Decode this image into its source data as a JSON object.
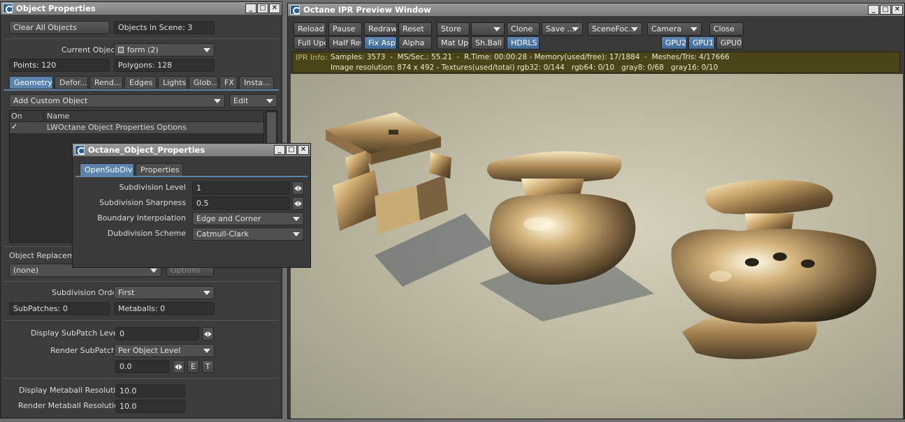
{
  "object_properties": {
    "title": "Object Properties",
    "clear_all": "Clear All Objects",
    "objects_in_scene": "Objects in Scene: 3",
    "current_object_label": "Current Object",
    "current_object_value": "form (2)",
    "points": "Points: 120",
    "polygons": "Polygons: 128",
    "tabs": [
      "Geometry",
      "Defor...",
      "Rend...",
      "Edges",
      "Lights",
      "Glob...",
      "FX",
      "Insta..."
    ],
    "add_custom_object": "Add Custom Object",
    "edit": "Edit",
    "list_headers": {
      "on": "On",
      "name": "Name"
    },
    "list_rows": [
      {
        "on": "✓",
        "name": "LWOctane Object Properties Options"
      }
    ],
    "object_replacement_label": "Object Replaceme",
    "object_replacement_value": "(none)",
    "options": "Options",
    "subdivision_order_label": "Subdivision Order",
    "subdivision_order_value": "First",
    "subpatches": "SubPatches: 0",
    "metaballs": "Metaballs: 0",
    "display_subpatch_label": "Display SubPatch Level",
    "display_subpatch_value": "0",
    "render_subpatch_label": "Render SubPatch",
    "render_subpatch_value": "Per Object Level",
    "render_subpatch_num": "0.0",
    "e_btn": "E",
    "t_btn": "T",
    "display_metaball_label": "Display Metaball Resolution",
    "display_metaball_value": "10.0",
    "render_metaball_label": "Render Metaball Resolution",
    "render_metaball_value": "10.0"
  },
  "octane_object": {
    "title": "Octane_Object_Properties",
    "tabs": [
      "OpenSubDiv",
      "Properties"
    ],
    "rows": [
      {
        "label": "Subdivision Level",
        "value": "1"
      },
      {
        "label": "Subdivision Sharpness",
        "value": "0.5"
      },
      {
        "label": "Boundary Interpolation",
        "value": "Edge and Corner"
      },
      {
        "label": "Dubdivision Scheme",
        "value": "Catmull-Clark"
      }
    ]
  },
  "ipr": {
    "title": "Octane IPR Preview Window",
    "row1": [
      "Reload",
      "Pause",
      "Redraw",
      "Reset",
      "Store",
      "",
      "Clone",
      "Save ...",
      "SceneFoc...",
      "Camera",
      "Close"
    ],
    "row2": [
      "Full Upd.",
      "Half Res",
      "Fix Asp.",
      "Alpha",
      "Mat Upd",
      "Sh.Ball",
      "HDRLS",
      "GPU2",
      "GPU1",
      "GPU0"
    ],
    "info_label": "IPR Info:",
    "info_line1": "Samples: 3573  -  MS/Sec.: 55.21  -  R.Time: 00:00:28 - Memory(used/free): 17/1884  -  Meshes/Tris: 4/17666",
    "info_line2": "Image resolution: 874 x 492 - Textures(used/total) rgb32: 0/144   rgb64: 0/10   gray8: 0/68   gray16: 0/10"
  },
  "window_buttons": {
    "min": "_",
    "max": "□",
    "close": "✕"
  }
}
